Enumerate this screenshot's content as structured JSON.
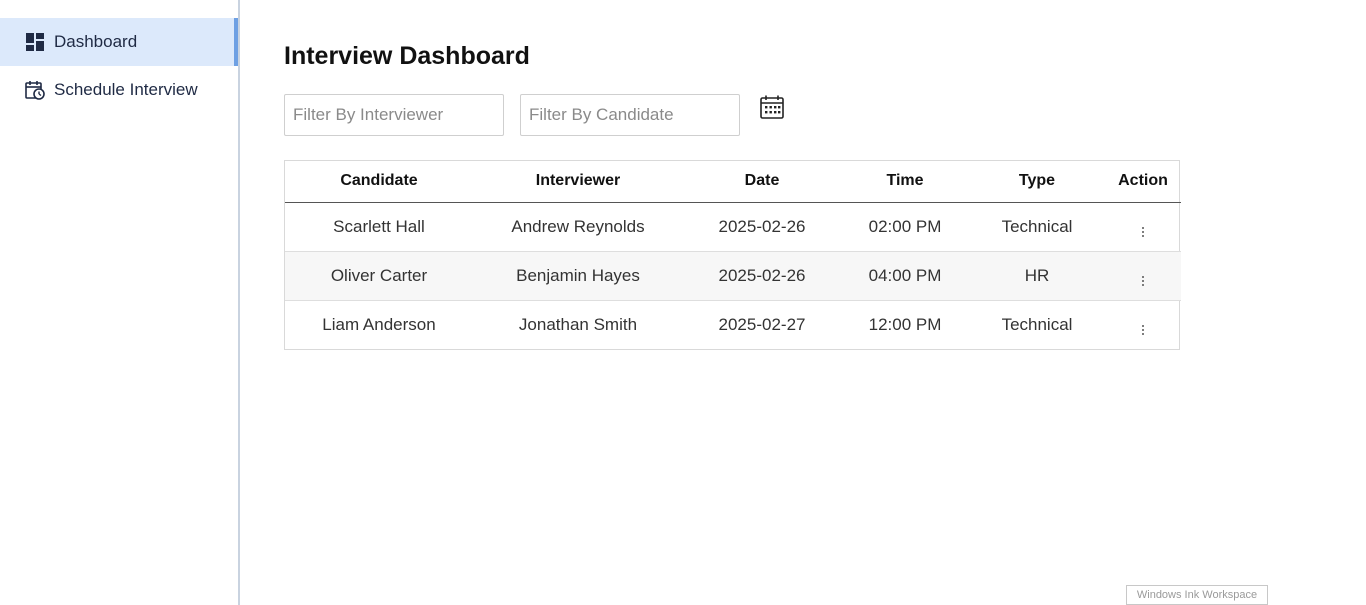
{
  "sidebar": {
    "items": [
      {
        "label": "Dashboard",
        "icon": "dashboard-icon",
        "active": true
      },
      {
        "label": "Schedule Interview",
        "icon": "calendar-clock-icon",
        "active": false
      }
    ]
  },
  "main": {
    "title": "Interview Dashboard",
    "filters": {
      "interviewer_placeholder": "Filter By Interviewer",
      "candidate_placeholder": "Filter By Candidate",
      "interviewer_value": "",
      "candidate_value": "",
      "calendar_icon": "calendar-icon"
    },
    "table": {
      "columns": [
        "Candidate",
        "Interviewer",
        "Date",
        "Time",
        "Type",
        "Action"
      ],
      "rows": [
        {
          "candidate": "Scarlett Hall",
          "interviewer": "Andrew Reynolds",
          "date": "2025-02-26",
          "time": "02:00 PM",
          "type": "Technical"
        },
        {
          "candidate": "Oliver Carter",
          "interviewer": "Benjamin Hayes",
          "date": "2025-02-26",
          "time": "04:00 PM",
          "type": "HR"
        },
        {
          "candidate": "Liam Anderson",
          "interviewer": "Jonathan Smith",
          "date": "2025-02-27",
          "time": "12:00 PM",
          "type": "Technical"
        }
      ]
    }
  },
  "overlay": {
    "ink_workspace_label": "Windows Ink Workspace"
  },
  "colors": {
    "active_nav_bg": "#dce9fb",
    "active_nav_accent": "#6ea0e3"
  }
}
